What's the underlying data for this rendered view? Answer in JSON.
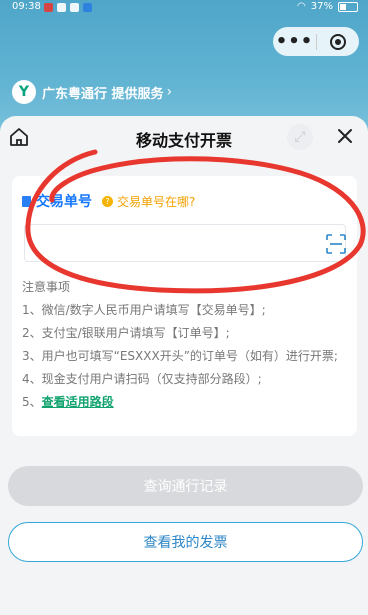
{
  "status_bar": {
    "time": "09:38",
    "battery": "37%"
  },
  "provider": {
    "text": "广东粤通行 提供服务",
    "chevron": "›"
  },
  "header": {
    "title": "移动支付开票"
  },
  "card": {
    "field_label": "交易单号",
    "help_link": "交易单号在哪?",
    "input_value": "",
    "notes_title": "注意事项",
    "notes": [
      "1、微信/数字人民币用户请填写【交易单号】;",
      "2、支付宝/银联用户请填写【订单号】;",
      "3、用户也可填写“ESXXX开头”的订单号（如有）进行开票;",
      "4、现金支付用户请扫码（仅支持部分路段）;"
    ],
    "note5_prefix": "5、",
    "note5_link": "查看适用路段"
  },
  "buttons": {
    "query": "查询通行记录",
    "my_invoices": "查看我的发票"
  },
  "colors": {
    "accent": "#1677ff",
    "green": "#12a36f",
    "annotation_red": "#e8372e"
  }
}
